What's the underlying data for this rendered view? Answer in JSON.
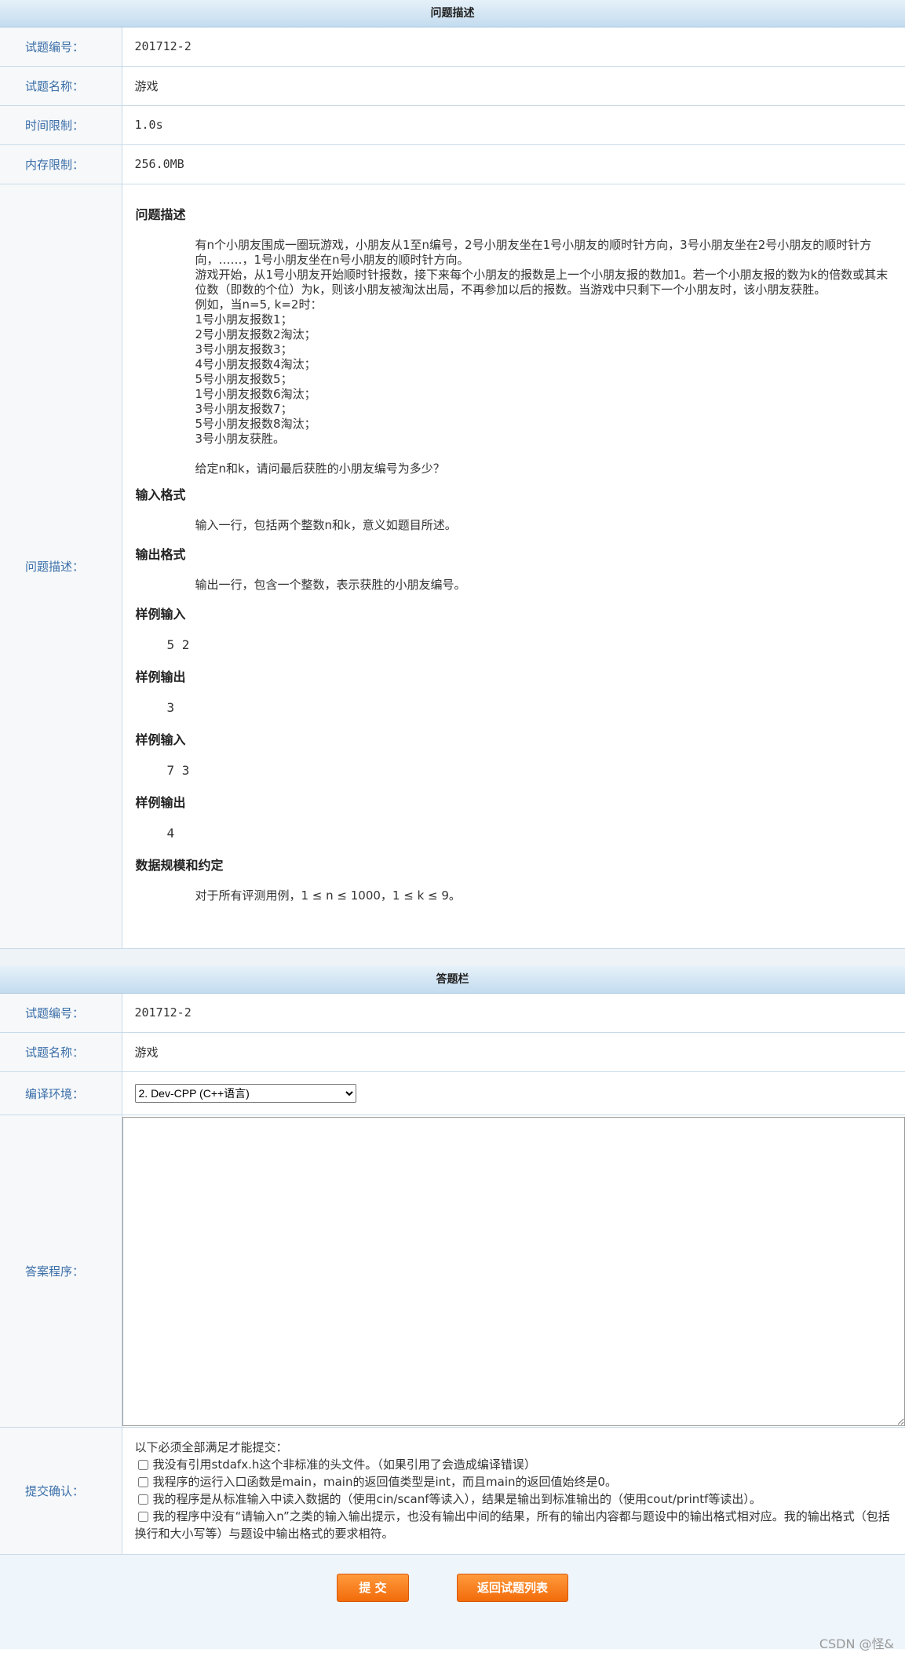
{
  "problem_section": {
    "header": "问题描述",
    "rows": [
      {
        "label": "试题编号：",
        "value": "201712-2"
      },
      {
        "label": "试题名称：",
        "value": "游戏"
      },
      {
        "label": "时间限制：",
        "value": "1.0s"
      },
      {
        "label": "内存限制：",
        "value": "256.0MB"
      }
    ],
    "desc_label": "问题描述：",
    "desc_heading": "问题描述",
    "desc_para1": "有n个小朋友围成一圈玩游戏，小朋友从1至n编号，2号小朋友坐在1号小朋友的顺时针方向，3号小朋友坐在2号小朋友的顺时针方向，……，1号小朋友坐在n号小朋友的顺时针方向。",
    "desc_para2": "游戏开始，从1号小朋友开始顺时针报数，接下来每个小朋友的报数是上一个小朋友报的数加1。若一个小朋友报的数为k的倍数或其末位数（即数的个位）为k，则该小朋友被淘汰出局，不再参加以后的报数。当游戏中只剩下一个小朋友时，该小朋友获胜。",
    "example_lines": [
      "例如，当n=5, k=2时：",
      "1号小朋友报数1；",
      "2号小朋友报数2淘汰；",
      "3号小朋友报数3；",
      "4号小朋友报数4淘汰；",
      "5号小朋友报数5；",
      "1号小朋友报数6淘汰；",
      "3号小朋友报数7；",
      "5号小朋友报数8淘汰；",
      "3号小朋友获胜。"
    ],
    "question": "给定n和k，请问最后获胜的小朋友编号为多少？",
    "input_heading": "输入格式",
    "input_text": "输入一行，包括两个整数n和k，意义如题目所述。",
    "output_heading": "输出格式",
    "output_text": "输出一行，包含一个整数，表示获胜的小朋友编号。",
    "sample_in1_heading": "样例输入",
    "sample_in1": "5 2",
    "sample_out1_heading": "样例输出",
    "sample_out1": "3",
    "sample_in2_heading": "样例输入",
    "sample_in2": "7 3",
    "sample_out2_heading": "样例输出",
    "sample_out2": "4",
    "scale_heading": "数据规模和约定",
    "scale_text": "对于所有评测用例，1 ≤ n ≤ 1000，1 ≤ k ≤ 9。"
  },
  "answer_section": {
    "header": "答题栏",
    "id_label": "试题编号：",
    "id_value": "201712-2",
    "name_label": "试题名称：",
    "name_value": "游戏",
    "env_label": "编译环境：",
    "env_selected": "2. Dev-CPP (C++语言)",
    "code_label": "答案程序：",
    "code_value": "",
    "confirm_label": "提交确认：",
    "confirm_intro": "以下必须全部满足才能提交：",
    "confirm_items": [
      "我没有引用stdafx.h这个非标准的头文件。（如果引用了会造成编译错误）",
      "我程序的运行入口函数是main，main的返回值类型是int，而且main的返回值始终是0。",
      "我的程序是从标准输入中读入数据的（使用cin/scanf等读入），结果是输出到标准输出的（使用cout/printf等读出）。",
      "我的程序中没有“请输入n”之类的输入输出提示，也没有输出中间的结果，所有的输出内容都与题设中的输出格式相对应。我的输出格式（包括换行和大小写等）与题设中输出格式的要求相符。"
    ]
  },
  "buttons": {
    "submit": "提  交",
    "back": "返回试题列表"
  },
  "watermark": "CSDN @怪&"
}
